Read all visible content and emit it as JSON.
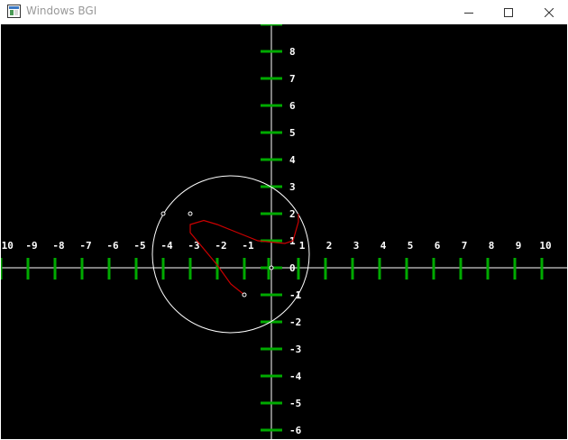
{
  "window": {
    "title": "Windows BGI",
    "icons": {
      "app": "bgi-window-icon",
      "minimize": "minimize-icon",
      "maximize": "maximize-icon",
      "close": "close-icon"
    }
  },
  "colors": {
    "background": "#000000",
    "axis": "#ffffff",
    "tick": "#00aa00",
    "curve": "#cc0000",
    "circle": "#ffffff",
    "label": "#ffffff"
  },
  "chart_data": {
    "type": "scatter",
    "x_ticks": [
      "-10",
      "-9",
      "-8",
      "-7",
      "-6",
      "-5",
      "-4",
      "-3",
      "-2",
      "-1",
      "1",
      "2",
      "3",
      "4",
      "5",
      "6",
      "7",
      "8",
      "9",
      "10"
    ],
    "y_ticks": [
      "8",
      "7",
      "6",
      "5",
      "4",
      "3",
      "2",
      "1",
      "0",
      "-1",
      "-2",
      "-3",
      "-4",
      "-5",
      "-6"
    ],
    "xlim": [
      -10,
      10
    ],
    "ylim": [
      -6,
      8
    ],
    "circle": {
      "center": [
        -1.5,
        0.5
      ],
      "radius": 2.9
    },
    "control_points": [
      {
        "x": -4,
        "y": 2
      },
      {
        "x": -3,
        "y": 2
      },
      {
        "x": 0,
        "y": 0
      },
      {
        "x": -1,
        "y": -1
      }
    ],
    "curve": [
      [
        -1,
        -1
      ],
      [
        -1.5,
        -0.6
      ],
      [
        -2,
        0.1
      ],
      [
        -2.5,
        0.7
      ],
      [
        -3,
        1.3
      ],
      [
        -3,
        1.6
      ],
      [
        -2.5,
        1.75
      ],
      [
        -2,
        1.6
      ],
      [
        -1.5,
        1.4
      ],
      [
        -1,
        1.2
      ],
      [
        -0.5,
        1
      ],
      [
        0,
        0.95
      ],
      [
        0.5,
        0.9
      ],
      [
        0.8,
        1
      ],
      [
        1,
        1.7
      ],
      [
        1,
        2
      ]
    ]
  }
}
